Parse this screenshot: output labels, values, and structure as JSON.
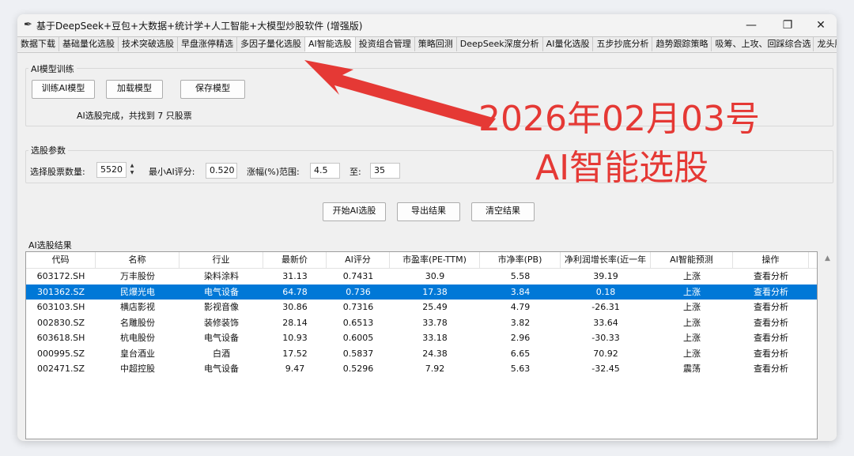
{
  "window": {
    "title": "基于DeepSeek+豆包+大数据+统计学+人工智能+大模型炒股软件 (增强版)",
    "app_icon": "feather-icon",
    "controls": {
      "minimize": "—",
      "maximize": "❐",
      "close": "✕"
    }
  },
  "tabs": [
    {
      "label": "数据下载",
      "active": false
    },
    {
      "label": "基础量化选股",
      "active": false
    },
    {
      "label": "技术突破选股",
      "active": false
    },
    {
      "label": "早盘涨停精选",
      "active": false
    },
    {
      "label": "多因子量化选股",
      "active": false
    },
    {
      "label": "AI智能选股",
      "active": true
    },
    {
      "label": "投资组合管理",
      "active": false
    },
    {
      "label": "策略回测",
      "active": false
    },
    {
      "label": "DeepSeek深度分析",
      "active": false
    },
    {
      "label": "AI量化选股",
      "active": false
    },
    {
      "label": "五步抄底分析",
      "active": false
    },
    {
      "label": "趋势跟踪策略",
      "active": false
    },
    {
      "label": "吸筹、上攻、回踩综合选",
      "active": false
    },
    {
      "label": "龙头股与连板股",
      "active": false
    }
  ],
  "training": {
    "group_label": "AI模型训练",
    "buttons": {
      "train": "训练AI模型",
      "load": "加载模型",
      "save": "保存模型"
    },
    "status": "AI选股完成，共找到 7 只股票"
  },
  "params": {
    "group_label": "选股参数",
    "count_label": "选择股票数量:",
    "count_value": "5520",
    "min_score_label": "最小AI评分:",
    "min_score_value": "0.520",
    "range_label": "涨幅(%)范围:",
    "range_min": "4.5",
    "to_label": "至:",
    "range_max": "35"
  },
  "actions": {
    "start": "开始AI选股",
    "export": "导出结果",
    "clear": "清空结果"
  },
  "results": {
    "label": "AI选股结果",
    "columns": [
      "代码",
      "名称",
      "行业",
      "最新价",
      "AI评分",
      "市盈率(PE-TTM)",
      "市净率(PB)",
      "净利润增长率(近一年",
      "AI智能预测",
      "操作"
    ],
    "rows": [
      [
        "603172.SH",
        "万丰股份",
        "染料涂料",
        "31.13",
        "0.7431",
        "30.9",
        "5.58",
        "39.19",
        "上涨",
        "查看分析"
      ],
      [
        "301362.SZ",
        "民爆光电",
        "电气设备",
        "64.78",
        "0.736",
        "17.38",
        "3.84",
        "0.18",
        "上涨",
        "查看分析"
      ],
      [
        "603103.SH",
        "横店影视",
        "影视音像",
        "30.86",
        "0.7316",
        "25.49",
        "4.79",
        "-26.31",
        "上涨",
        "查看分析"
      ],
      [
        "002830.SZ",
        "名雕股份",
        "装修装饰",
        "28.14",
        "0.6513",
        "33.78",
        "3.82",
        "33.64",
        "上涨",
        "查看分析"
      ],
      [
        "603618.SH",
        "杭电股份",
        "电气设备",
        "10.93",
        "0.6005",
        "33.18",
        "2.96",
        "-30.33",
        "上涨",
        "查看分析"
      ],
      [
        "000995.SZ",
        "皇台酒业",
        "白酒",
        "17.52",
        "0.5837",
        "24.38",
        "6.65",
        "70.92",
        "上涨",
        "查看分析"
      ],
      [
        "002471.SZ",
        "中超控股",
        "电气设备",
        "9.47",
        "0.5296",
        "7.92",
        "5.63",
        "-32.45",
        "震荡",
        "查看分析"
      ]
    ],
    "selected_row": 1,
    "scroll_up_icon": "▲"
  },
  "annotation": {
    "line1": "2026年02月03号",
    "line2": "AI智能选股",
    "color": "#e53935",
    "arrow_icon": "red-arrow-icon"
  }
}
